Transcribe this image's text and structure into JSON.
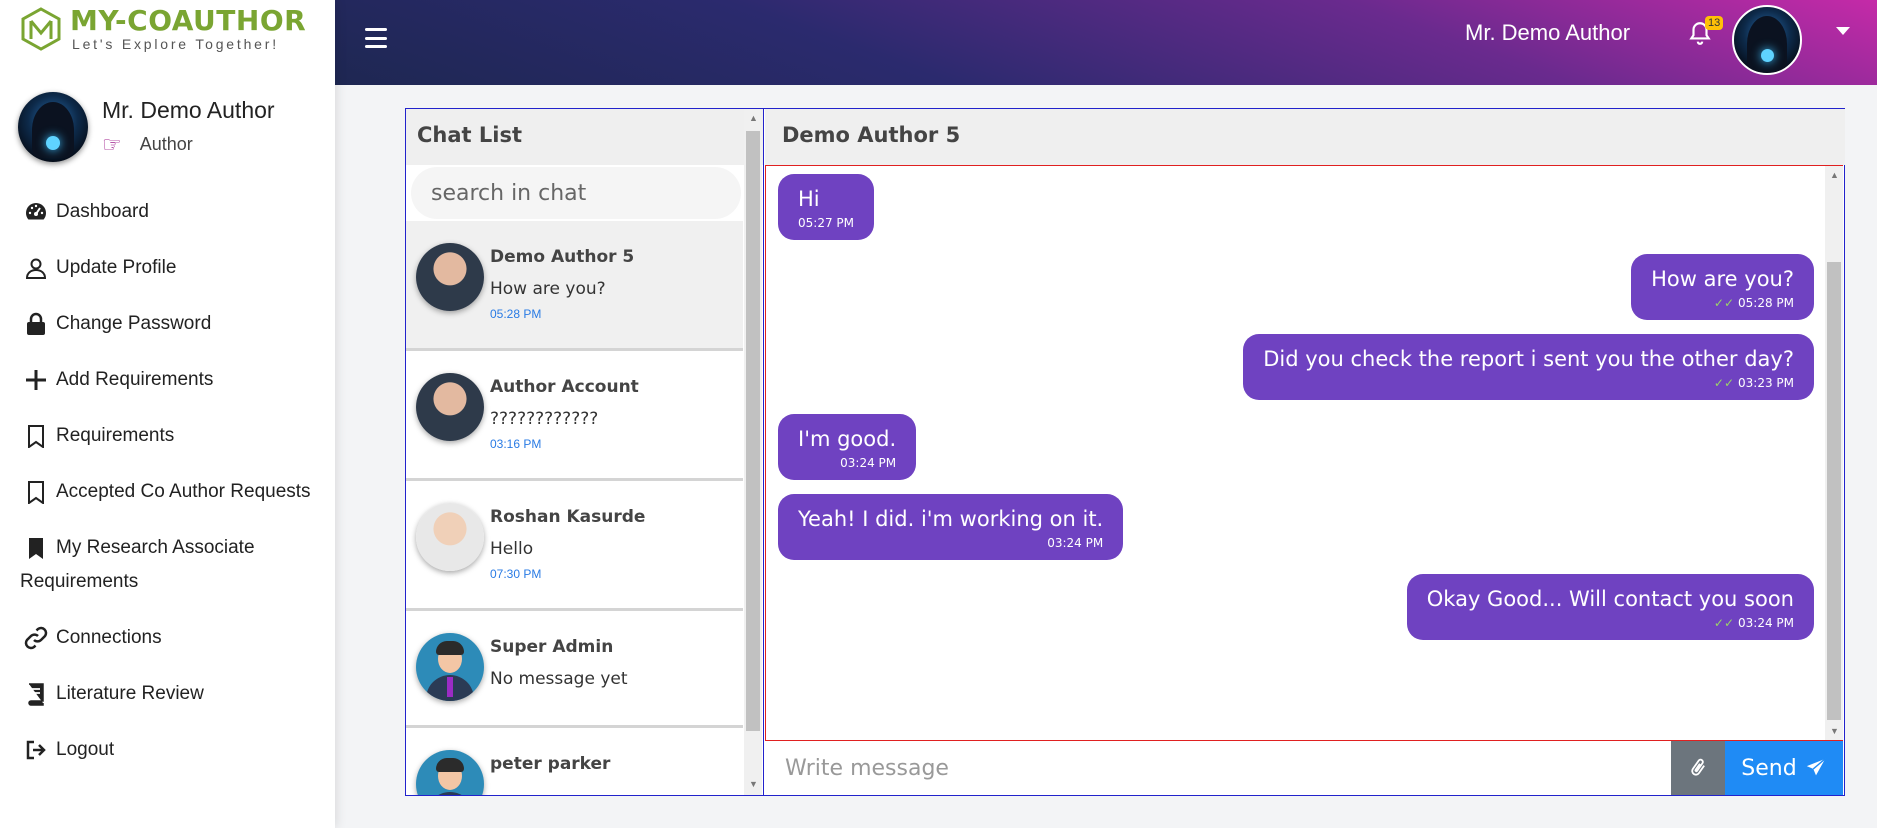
{
  "brand": {
    "name": "MY-COAUTHOR",
    "tagline": "Let's Explore Together!"
  },
  "sidebar": {
    "profile": {
      "name": "Mr. Demo Author",
      "role": "Author"
    },
    "items": [
      {
        "label": "Dashboard",
        "icon": "speedometer-icon"
      },
      {
        "label": "Update Profile",
        "icon": "user-icon"
      },
      {
        "label": "Change Password",
        "icon": "lock-icon"
      },
      {
        "label": "Add Requirements",
        "icon": "plus-icon"
      },
      {
        "label": "Requirements",
        "icon": "bookmark-icon"
      },
      {
        "label": "Accepted Co Author Requests",
        "icon": "bookmark-icon"
      },
      {
        "label": "My Research Associate Requirements",
        "icon": "bookmark-filled-icon"
      },
      {
        "label": "Connections",
        "icon": "link-icon"
      },
      {
        "label": "Literature Review",
        "icon": "book-icon"
      },
      {
        "label": "Logout",
        "icon": "logout-icon"
      }
    ]
  },
  "topbar": {
    "user_name": "Mr. Demo Author",
    "notification_count": "13"
  },
  "chat_list": {
    "title": "Chat List",
    "search_placeholder": "search in chat",
    "contacts": [
      {
        "name": "Demo Author 5",
        "last_message": "How are you?",
        "time": "05:28 PM"
      },
      {
        "name": "Author Account",
        "last_message": "????????????",
        "time": "03:16 PM"
      },
      {
        "name": "Roshan Kasurde",
        "last_message": "Hello",
        "time": "07:30 PM"
      },
      {
        "name": "Super Admin",
        "last_message": "No message yet",
        "time": ""
      },
      {
        "name": "peter parker",
        "last_message": "",
        "time": ""
      }
    ]
  },
  "conversation": {
    "title": "Demo Author 5",
    "messages": [
      {
        "direction": "in",
        "text": "Hi",
        "time": "05:27 PM"
      },
      {
        "direction": "out",
        "text": "How are you?",
        "time": "05:28 PM",
        "status": "✓✓"
      },
      {
        "direction": "out",
        "text": "Did you check the report i sent you the other day?",
        "time": "03:23 PM",
        "status": "✓✓"
      },
      {
        "direction": "in",
        "text": "I'm good.",
        "time": "03:24 PM"
      },
      {
        "direction": "in",
        "text": "Yeah! I did. i'm working on it.",
        "time": "03:24 PM"
      },
      {
        "direction": "out",
        "text": "Okay Good... Will contact you soon",
        "time": "03:24 PM",
        "status": "✓✓"
      }
    ],
    "composer_placeholder": "Write message",
    "send_label": "Send"
  },
  "colors": {
    "bubble": "#6f42c1",
    "send_button": "#1f8bf5",
    "brand_green": "#7aa532",
    "timestamp_blue": "#2a7be4"
  }
}
